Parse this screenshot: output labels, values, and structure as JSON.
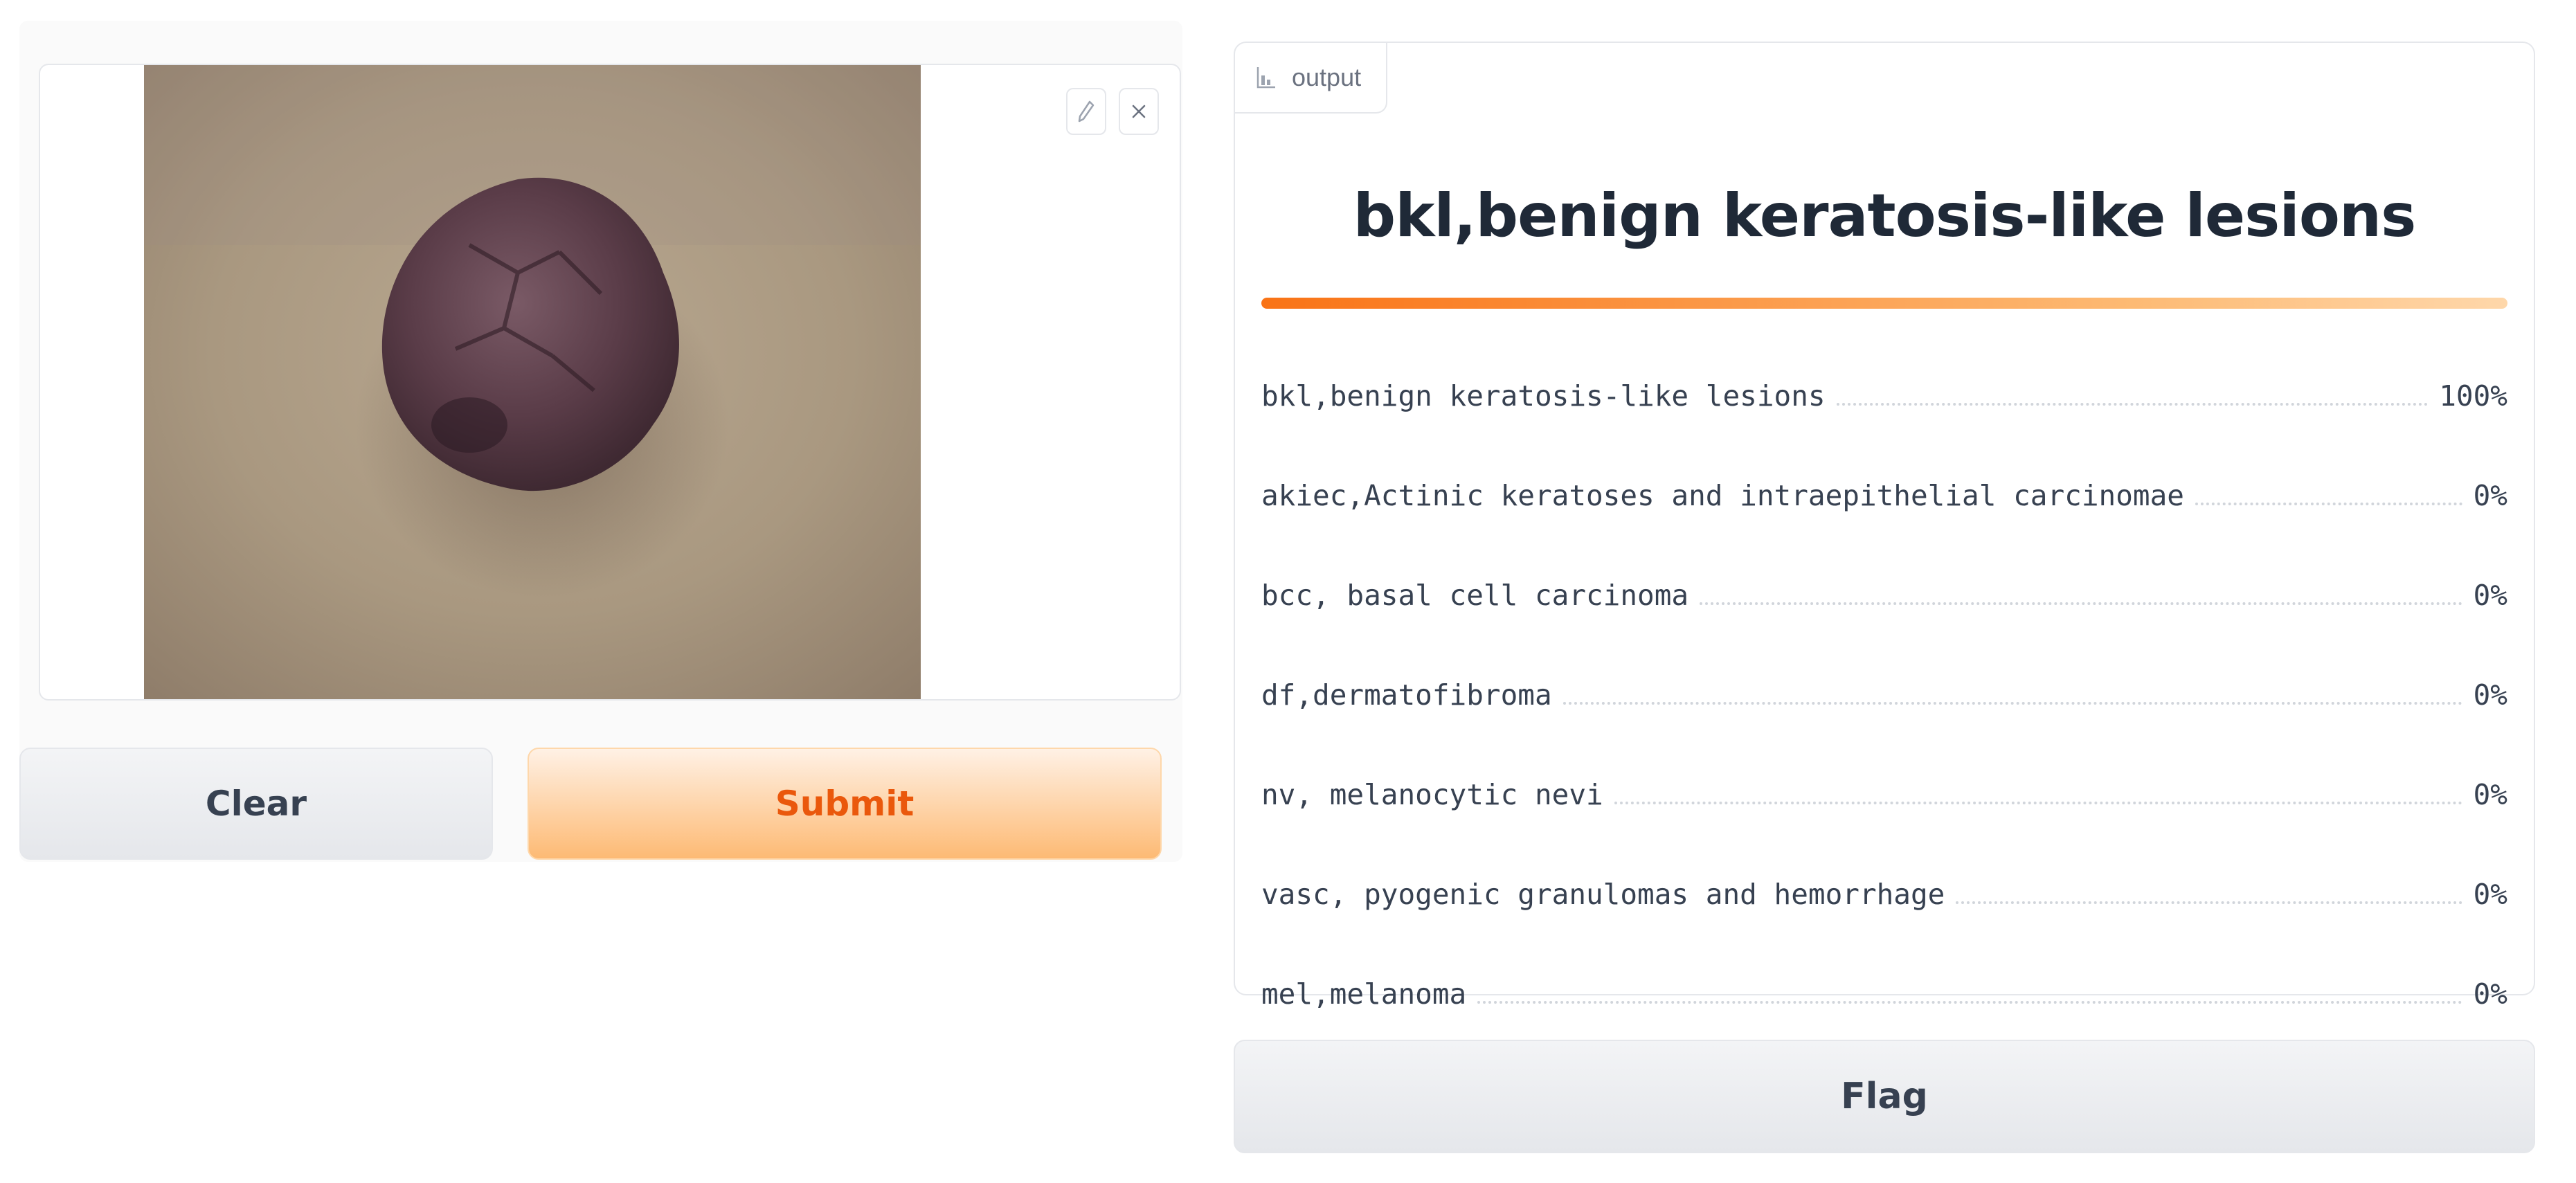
{
  "input": {
    "image_alt": "skin lesion photo",
    "edit_icon": "pencil-icon",
    "close_icon": "close-icon"
  },
  "buttons": {
    "clear_label": "Clear",
    "submit_label": "Submit",
    "flag_label": "Flag"
  },
  "output": {
    "tag_label": "output",
    "tag_icon": "chart-icon",
    "predicted_label": "bkl,benign keratosis-like lesions",
    "top_confidence": 1.0,
    "confidences": [
      {
        "label": "bkl,benign keratosis-like lesions",
        "value": "100%"
      },
      {
        "label": "akiec,Actinic keratoses and intraepithelial carcinomae",
        "value": "0%"
      },
      {
        "label": "bcc, basal cell carcinoma",
        "value": "0%"
      },
      {
        "label": "df,dermatofibroma",
        "value": "0%"
      },
      {
        "label": "nv, melanocytic nevi",
        "value": "0%"
      },
      {
        "label": "vasc, pyogenic granulomas and hemorrhage",
        "value": "0%"
      },
      {
        "label": "mel,melanoma",
        "value": "0%"
      }
    ]
  },
  "colors": {
    "accent": "#f97316",
    "submit_text": "#ea580c"
  }
}
